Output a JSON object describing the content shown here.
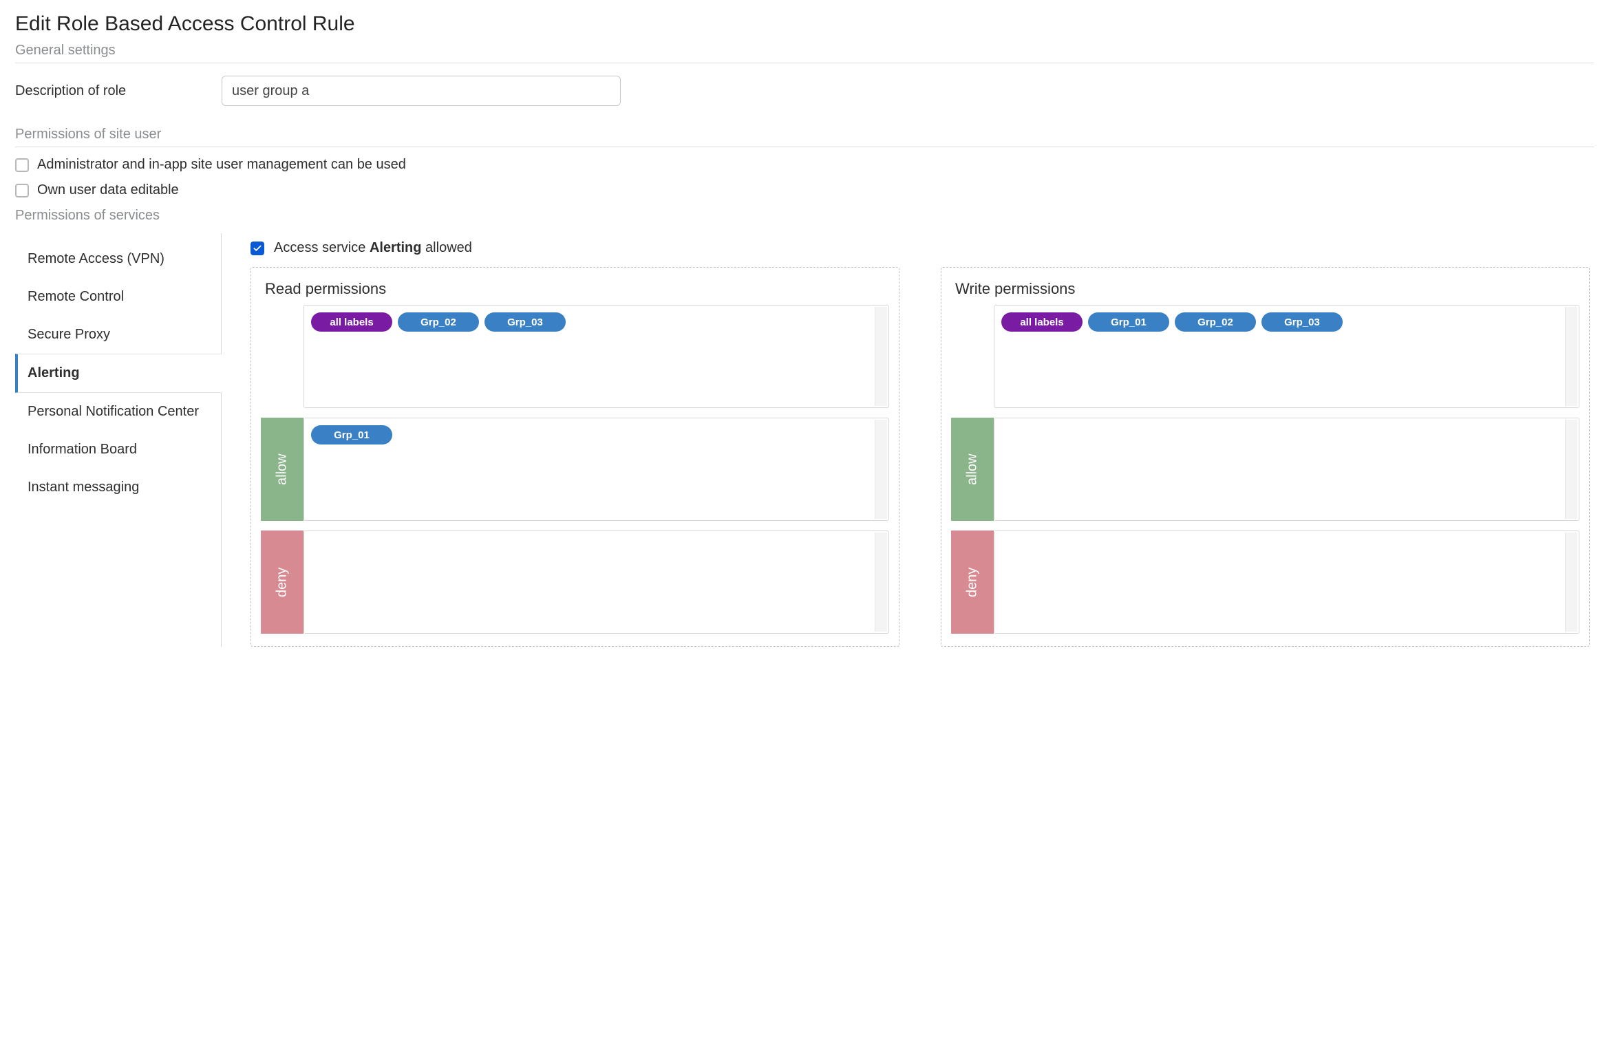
{
  "page": {
    "title": "Edit Role Based Access Control Rule"
  },
  "sections": {
    "general": "General settings",
    "site_user": "Permissions of site user",
    "services": "Permissions of services"
  },
  "description": {
    "label": "Description of role",
    "value": "user group a"
  },
  "site_user_perms": [
    {
      "label": "Administrator and in-app site user management can be used",
      "checked": false
    },
    {
      "label": "Own user data editable",
      "checked": false
    }
  ],
  "service_nav": [
    {
      "label": "Remote Access (VPN)",
      "active": false
    },
    {
      "label": "Remote Control",
      "active": false
    },
    {
      "label": "Secure Proxy",
      "active": false
    },
    {
      "label": "Alerting",
      "active": true
    },
    {
      "label": "Personal Notification Center",
      "active": false
    },
    {
      "label": "Information Board",
      "active": false
    },
    {
      "label": "Instant messaging",
      "active": false
    }
  ],
  "access": {
    "prefix": "Access service ",
    "service": "Alerting",
    "suffix": " allowed",
    "checked": true
  },
  "perms": {
    "read": {
      "title": "Read permissions",
      "available": [
        {
          "text": "all labels",
          "color": "purple"
        },
        {
          "text": "Grp_02",
          "color": "blue"
        },
        {
          "text": "Grp_03",
          "color": "blue"
        }
      ],
      "allow_label": "allow",
      "allow": [
        {
          "text": "Grp_01",
          "color": "blue"
        }
      ],
      "deny_label": "deny",
      "deny": []
    },
    "write": {
      "title": "Write permissions",
      "available": [
        {
          "text": "all labels",
          "color": "purple"
        },
        {
          "text": "Grp_01",
          "color": "blue"
        },
        {
          "text": "Grp_02",
          "color": "blue"
        },
        {
          "text": "Grp_03",
          "color": "blue"
        }
      ],
      "allow_label": "allow",
      "allow": [],
      "deny_label": "deny",
      "deny": []
    }
  }
}
